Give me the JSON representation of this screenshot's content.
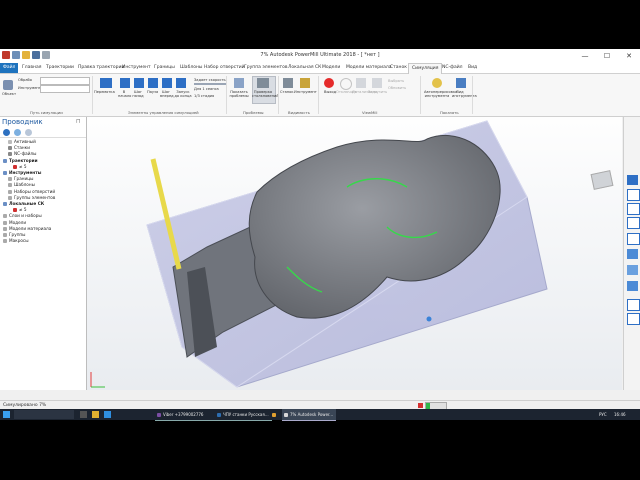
{
  "window": {
    "title": "7% Autodesk PowerMill Ultimate 2018 - [ *нет ]",
    "controls": [
      "—",
      "☐",
      "✕"
    ]
  },
  "tabs": {
    "file": "Файл",
    "items": [
      "Главная",
      "Траектории",
      "Правка траектории",
      "Инструмент",
      "Границы",
      "Шаблоны",
      "Набор отверстий",
      "Группа элементов",
      "Локальная СК",
      "Модели",
      "Модели материала",
      "Станок",
      "Симуляция",
      "NC-файл",
      "Вид"
    ],
    "active": "Симуляция"
  },
  "ribbon": {
    "object_label": "Объект",
    "fields": [
      "Обрабо",
      "Инструмент"
    ],
    "group_path": "Путь симуляции",
    "rewind": "Перемотка",
    "to_start": "В начало",
    "step_back": "Шаг назад",
    "pause": "Пауза",
    "step_fwd": "Шаг вперед",
    "run_to_end": "Запуск до конца",
    "speed_1": "Задает скорость",
    "speed_2": "Для 1 сеанса",
    "speed_3": "1/3 стадия",
    "group_controls": "Элементы управления симуляцией",
    "show_problems": "Показать проблемы",
    "check_collisions": "Проверка столкновений",
    "group_problems": "Проблемы",
    "machine": "Станок",
    "tool": "Инструмент",
    "group_visibility": "Видимость",
    "exit": "Выход",
    "vm_1": "Отключить",
    "vm_2": "Детализация",
    "vm_3": "Загрузить",
    "vm_4": "Выбрать",
    "vm_5": "Обновить",
    "group_viewmill": "ViewMill",
    "autorecolor": "Автоперерисовка инструмента",
    "view_tool": "Вид инструмента",
    "group_show": "Показать"
  },
  "explorer": {
    "title": "Проводник",
    "items": [
      {
        "label": "Активный",
        "level": 1,
        "color": "#bbbbbb"
      },
      {
        "label": "Станки",
        "level": 1,
        "color": "#888888"
      },
      {
        "label": "NC-файлы",
        "level": 1,
        "color": "#888888"
      },
      {
        "label": "Траектории",
        "level": 0,
        "color": "#6b8fc5",
        "bold": true
      },
      {
        "label": "≠ 5",
        "level": 2,
        "color": "#d03030"
      },
      {
        "label": "Инструменты",
        "level": 0,
        "color": "#6b8fc5",
        "bold": true
      },
      {
        "label": "Границы",
        "level": 1,
        "color": "#aaaaaa"
      },
      {
        "label": "Шаблоны",
        "level": 1,
        "color": "#aaaaaa"
      },
      {
        "label": "Наборы отверстий",
        "level": 1,
        "color": "#aaaaaa"
      },
      {
        "label": "Группы элементов",
        "level": 1,
        "color": "#aaaaaa"
      },
      {
        "label": "Локальные СК",
        "level": 0,
        "color": "#6b8fc5",
        "bold": true
      },
      {
        "label": "≠ 5",
        "level": 2,
        "color": "#d03030"
      },
      {
        "label": "Слои и наборы",
        "level": 0,
        "color": "#aaaaaa"
      },
      {
        "label": "Модели",
        "level": 0,
        "color": "#aaaaaa"
      },
      {
        "label": "Модели материала",
        "level": 0,
        "color": "#aaaaaa"
      },
      {
        "label": "Группы",
        "level": 0,
        "color": "#aaaaaa"
      },
      {
        "label": "Макросы",
        "level": 0,
        "color": "#aaaaaa"
      }
    ]
  },
  "status": {
    "text": "Симулировано 7%",
    "progress": 0.07
  },
  "taskbar": {
    "items": [
      {
        "label": "Viber +3799002776",
        "color": "#7b4ea3"
      },
      {
        "label": "ЧПУ станки Русская...",
        "color": "#2d6db0"
      },
      {
        "label": "",
        "color": "#e0a030"
      },
      {
        "label": "7% Autodesk Power...",
        "color": "#d8d8d8"
      }
    ],
    "lang": "РУС",
    "time": "16:46"
  }
}
